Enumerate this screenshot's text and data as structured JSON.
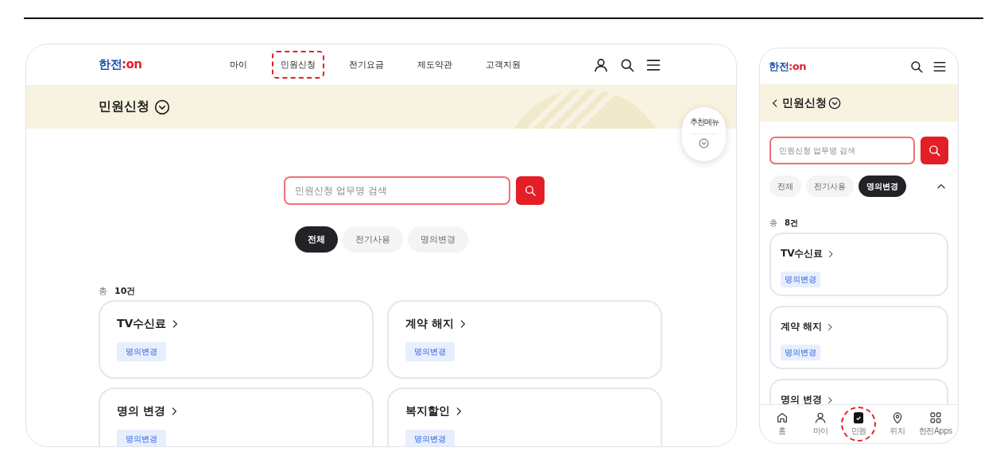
{
  "desktop": {
    "logo": {
      "main": "한전",
      "accent": ":on"
    },
    "nav": [
      {
        "label": "마이",
        "highlighted": false
      },
      {
        "label": "민원신청",
        "highlighted": true
      },
      {
        "label": "전기요금",
        "highlighted": false
      },
      {
        "label": "제도약관",
        "highlighted": false
      },
      {
        "label": "고객지원",
        "highlighted": false
      }
    ],
    "page_title": "민원신청",
    "recommend_button": "추천메뉴",
    "search": {
      "placeholder": "민원신청 업무명 검색"
    },
    "filters": [
      {
        "label": "전체",
        "selected": true
      },
      {
        "label": "전기사용",
        "selected": false
      },
      {
        "label": "명의변경",
        "selected": false
      }
    ],
    "count": {
      "prefix": "총",
      "value": "10건"
    },
    "cards": [
      {
        "title": "TV수신료",
        "tag": "명의변경"
      },
      {
        "title": "계약 해지",
        "tag": "명의변경"
      },
      {
        "title": "명의 변경",
        "tag": "명의변경"
      },
      {
        "title": "복지할인",
        "tag": "명의변경"
      }
    ]
  },
  "mobile": {
    "logo": {
      "main": "한전",
      "accent": ":on"
    },
    "page_title": "민원신청",
    "search": {
      "placeholder": "민원신청 업무명 검색"
    },
    "filters": [
      {
        "label": "전체",
        "selected": false
      },
      {
        "label": "전기사용",
        "selected": false
      },
      {
        "label": "명의변경",
        "selected": true
      }
    ],
    "filters_expanded": true,
    "count": {
      "prefix": "총",
      "value": "8건"
    },
    "cards": [
      {
        "title": "TV수신료",
        "tag": "명의변경"
      },
      {
        "title": "계약 해지",
        "tag": "명의변경"
      },
      {
        "title": "명의 변경"
      }
    ],
    "tabbar": [
      {
        "kind": "home",
        "label": "홈",
        "selected": false,
        "highlighted": false
      },
      {
        "kind": "person",
        "label": "마이",
        "selected": false,
        "highlighted": false
      },
      {
        "kind": "clipboard",
        "label": "민원",
        "selected": true,
        "highlighted": true
      },
      {
        "kind": "pin",
        "label": "위치",
        "selected": false,
        "highlighted": false
      },
      {
        "kind": "apps",
        "label": "한전Apps",
        "selected": false,
        "highlighted": false
      }
    ]
  }
}
